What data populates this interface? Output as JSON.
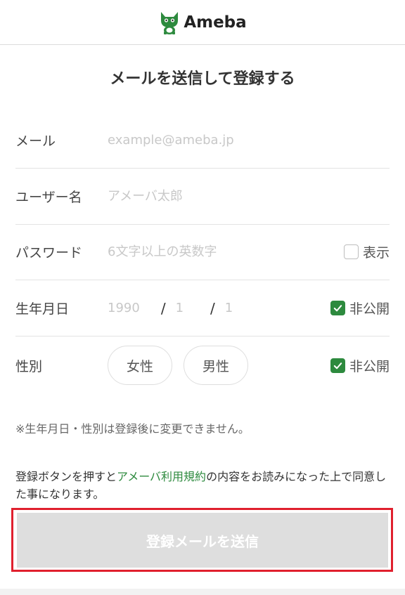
{
  "header": {
    "logo_text": "Ameba",
    "logo_icon": "ameba-mascot-icon",
    "brand_color": "#2d8a3e"
  },
  "page": {
    "title": "メールを送信して登録する"
  },
  "form": {
    "email": {
      "label": "メール",
      "placeholder": "example@ameba.jp",
      "value": ""
    },
    "username": {
      "label": "ユーザー名",
      "placeholder": "アメーバ太郎",
      "value": ""
    },
    "password": {
      "label": "パスワード",
      "placeholder": "6文字以上の英数字",
      "value": "",
      "show_label": "表示",
      "show_checked": false
    },
    "birthday": {
      "label": "生年月日",
      "year": "1990",
      "month": "1",
      "day": "1",
      "separator": "/",
      "private_label": "非公開",
      "private_checked": true
    },
    "gender": {
      "label": "性別",
      "options": [
        "女性",
        "男性"
      ],
      "private_label": "非公開",
      "private_checked": true
    }
  },
  "note": "※生年月日・性別は登録後に変更できません。",
  "terms": {
    "before": "登録ボタンを押すと",
    "link": "アメーバ利用規約",
    "after": "の内容をお読みになった上で同意した事になります。"
  },
  "submit": {
    "label": "登録メールを送信",
    "highlight_color": "#e0202e"
  }
}
